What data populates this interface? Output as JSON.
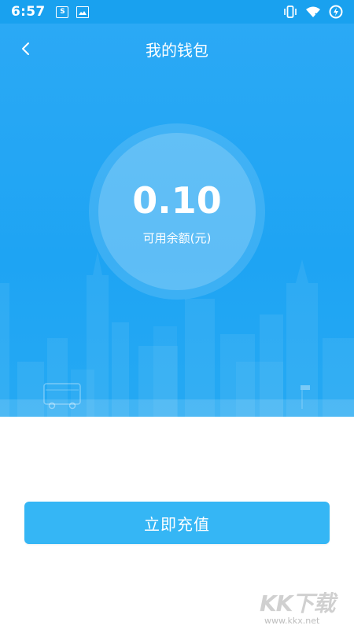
{
  "status_bar": {
    "time": "6:57",
    "left_icons": [
      "s-app-icon",
      "photo-app-icon"
    ],
    "right_icons": [
      "vibrate-icon",
      "wifi-icon",
      "data-saver-icon"
    ]
  },
  "header": {
    "title": "我的钱包",
    "back_icon": "chevron-left-icon"
  },
  "balance": {
    "amount": "0.10",
    "label": "可用余额(元)"
  },
  "actions": {
    "recharge_label": "立即充值"
  },
  "watermark": {
    "logo": "KK下载",
    "url": "www.kkx.net"
  },
  "colors": {
    "hero_blue": "#1ea4f3",
    "button_blue": "#35b6f5",
    "text_white": "#ffffff"
  }
}
